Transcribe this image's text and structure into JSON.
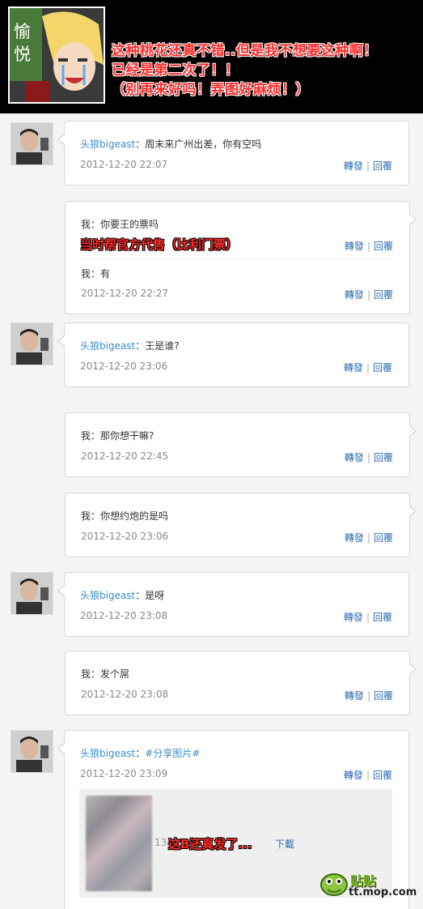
{
  "header": {
    "avatar_text": "愉悦",
    "lines": [
      "这种桃花还真不错..但是我不想要这种啊！",
      "已经是第二次了！！",
      "（别再来好吗！弄图好麻烦！）"
    ]
  },
  "actions": {
    "repost": "轉發",
    "separator": "|",
    "reply": "回覆"
  },
  "messages": [
    {
      "from": "other",
      "sender": "头狼bigeast",
      "text": "周末来广州出差，你有空吗",
      "time": "2012-12-20 22:07"
    },
    {
      "from": "me",
      "text": "你要王的票吗",
      "annotation": "当时帮官方代售（比利门票）",
      "followup_text": "有",
      "time": "2012-12-20 22:27"
    },
    {
      "from": "other",
      "sender": "头狼bigeast",
      "text": "王是谁?",
      "time": "2012-12-20 23:06"
    },
    {
      "from": "me",
      "text": "那你想干嘛?",
      "time": "2012-12-20 22:45"
    },
    {
      "from": "me",
      "text": "你想约炮的是吗",
      "time": "2012-12-20 23:06"
    },
    {
      "from": "other",
      "sender": "头狼bigeast",
      "text": "是呀",
      "time": "2012-12-20 23:08"
    },
    {
      "from": "me",
      "text": "发个屌",
      "time": "2012-12-20 23:08"
    },
    {
      "from": "other",
      "sender": "头狼bigeast",
      "text": "#分享图片#",
      "time": "2012-12-20 23:09"
    }
  ],
  "me_prefix": "我：",
  "attachment": {
    "size_text": "13...2k)",
    "download": "下載",
    "annotation": "这B还真发了..."
  },
  "watermark": {
    "title": "贴贴",
    "url": "tt.mop.com"
  },
  "colors": {
    "accent_red": "#ff2a2a",
    "link_blue": "#2f6db0",
    "name_blue": "#3c8cc8"
  }
}
